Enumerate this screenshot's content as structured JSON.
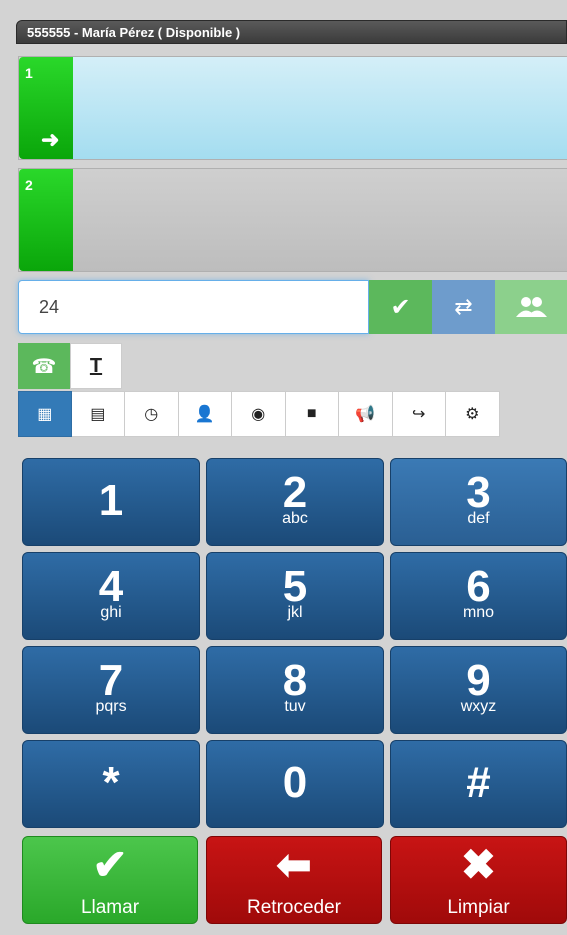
{
  "header": {
    "title": "555555 - María Pérez ( Disponible )"
  },
  "lines": [
    {
      "number": "1",
      "icon": "arrow-right-icon"
    },
    {
      "number": "2"
    }
  ],
  "dial": {
    "value": "24",
    "buttons": [
      "check-icon",
      "transfer-icon",
      "conference-icon"
    ]
  },
  "modes": [
    "phone-icon",
    "text-icon"
  ],
  "toolbar": [
    "keypad-icon",
    "list-icon",
    "clock-icon",
    "user-icon",
    "globe-icon",
    "chat-icon",
    "megaphone-icon",
    "share-icon",
    "gear-icon"
  ],
  "keypad": [
    {
      "digit": "1",
      "letters": ""
    },
    {
      "digit": "2",
      "letters": "abc"
    },
    {
      "digit": "3",
      "letters": "def"
    },
    {
      "digit": "4",
      "letters": "ghi"
    },
    {
      "digit": "5",
      "letters": "jkl"
    },
    {
      "digit": "6",
      "letters": "mno"
    },
    {
      "digit": "7",
      "letters": "pqrs"
    },
    {
      "digit": "8",
      "letters": "tuv"
    },
    {
      "digit": "9",
      "letters": "wxyz"
    },
    {
      "digit": "*",
      "letters": ""
    },
    {
      "digit": "0",
      "letters": ""
    },
    {
      "digit": "#",
      "letters": ""
    }
  ],
  "actions": {
    "call_label": "Llamar",
    "back_label": "Retroceder",
    "clear_label": "Limpiar"
  },
  "colors": {
    "green": "#5cb85c",
    "blue": "#337ab7",
    "keypad_blue": "#1b4a78",
    "red": "#a00a0a"
  }
}
